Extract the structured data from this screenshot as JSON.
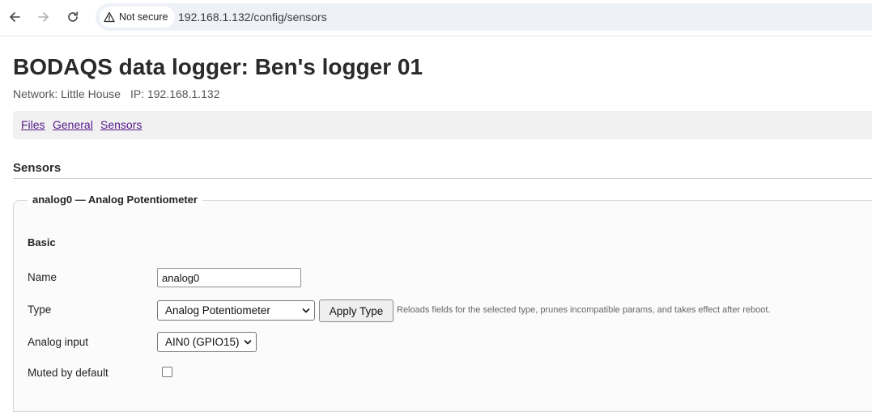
{
  "browser": {
    "security_label": "Not secure",
    "url": "192.168.1.132/config/sensors"
  },
  "header": {
    "title": "BODAQS data logger: Ben's logger 01",
    "network": "Network: Little House",
    "ip": "IP: 192.168.1.132"
  },
  "nav": {
    "items": [
      {
        "label": "Files"
      },
      {
        "label": "General"
      },
      {
        "label": "Sensors"
      }
    ]
  },
  "section": {
    "title": "Sensors"
  },
  "sensor": {
    "legend": "analog0 — Analog Potentiometer",
    "group_title": "Basic",
    "name_label": "Name",
    "name_value": "analog0",
    "type_label": "Type",
    "type_selected": "Analog Potentiometer",
    "apply_label": "Apply Type",
    "apply_hint": "Reloads fields for the selected type, prunes incompatible params, and takes effect after reboot.",
    "input_label": "Analog input",
    "input_selected": "AIN0 (GPIO15)",
    "muted_label": "Muted by default",
    "muted_checked": false
  },
  "colors": {
    "link_visited": "#551a8b",
    "omnibox_bg": "#eef1f8",
    "nav_bg": "#f1f1f1"
  }
}
